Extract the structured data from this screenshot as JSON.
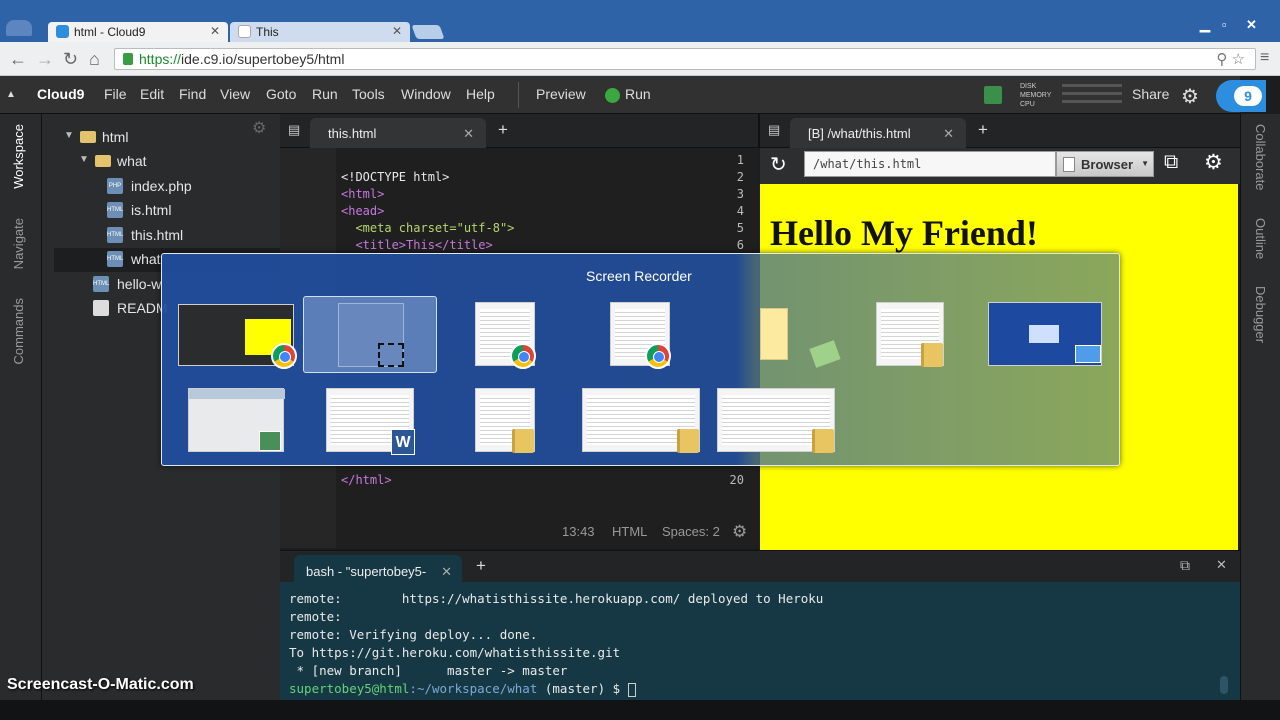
{
  "browser": {
    "tabs": [
      {
        "title": "html - Cloud9",
        "active": true
      },
      {
        "title": "This",
        "active": false
      }
    ],
    "url_scheme": "https://",
    "url_rest": "ide.c9.io/supertobey5/html"
  },
  "menubar": {
    "logo": "Cloud9",
    "items": [
      "File",
      "Edit",
      "Find",
      "View",
      "Goto",
      "Run",
      "Tools",
      "Window",
      "Help"
    ],
    "preview": "Preview",
    "run": "Run",
    "share": "Share",
    "metrics": [
      "DISK",
      "MEMORY",
      "CPU"
    ]
  },
  "left_panel_tabs": [
    "Workspace",
    "Navigate",
    "Commands"
  ],
  "right_panel_tabs": [
    "Collaborate",
    "Outline",
    "Debugger"
  ],
  "tree": [
    {
      "label": "html",
      "type": "folder",
      "depth": 0
    },
    {
      "label": "what",
      "type": "folder",
      "depth": 1
    },
    {
      "label": "index.php",
      "type": "file",
      "icon": "PHP",
      "depth": 2
    },
    {
      "label": "is.html",
      "type": "file",
      "icon": "HTML",
      "depth": 2
    },
    {
      "label": "this.html",
      "type": "file",
      "icon": "HTML",
      "depth": 2
    },
    {
      "label": "what",
      "type": "file",
      "icon": "HTML",
      "depth": 2
    },
    {
      "label": "hello-w",
      "type": "file",
      "icon": "HTML",
      "depth": 1
    },
    {
      "label": "READM",
      "type": "file",
      "icon": "doc",
      "depth": 1
    }
  ],
  "editor": {
    "tab": "this.html",
    "line_numbers": [
      "1",
      "2",
      "3",
      "4",
      "5",
      "6",
      "20"
    ],
    "lines": [
      "",
      "<!DOCTYPE html>",
      "<html>",
      "<head>",
      "  <meta charset=\"utf-8\">",
      "  <title>This</title>",
      "</html>"
    ],
    "status": {
      "position": "13:43",
      "mode": "HTML",
      "spaces": "Spaces: 2"
    }
  },
  "preview": {
    "tab": "[B] /what/this.html",
    "url": "/what/this.html",
    "browser_button": "Browser",
    "heading": "Hello My Friend!",
    "background": "#ffff00"
  },
  "terminal": {
    "tab": "bash - \"supertobey5-",
    "lines": [
      "remote:        https://whatisthissite.herokuapp.com/ deployed to Heroku",
      "remote:",
      "remote: Verifying deploy... done.",
      "To https://git.heroku.com/whatisthissite.git",
      " * [new branch]      master -> master"
    ],
    "prompt_user": "supertobey5@html",
    "prompt_path": ":~/workspace/what",
    "prompt_branch": " (master) $ "
  },
  "switcher": {
    "title": "Screen Recorder"
  },
  "watermark": "Screencast-O-Matic.com",
  "colors": {
    "accent": "#2d8ee0",
    "preview_bg": "#ffff00",
    "terminal_bg": "#153844"
  }
}
